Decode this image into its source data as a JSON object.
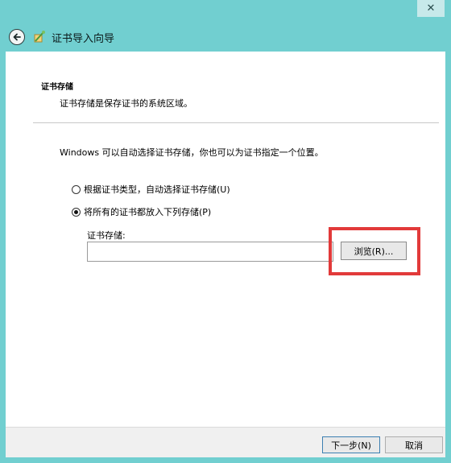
{
  "window": {
    "title": "证书导入向导",
    "close_label": "✕"
  },
  "section": {
    "title": "证书存储",
    "description": "证书存储是保存证书的系统区域。"
  },
  "content": {
    "intro": "Windows 可以自动选择证书存储，你也可以为证书指定一个位置。",
    "options": [
      {
        "label": "根据证书类型，自动选择证书存储(U)",
        "checked": false
      },
      {
        "label": "将所有的证书都放入下列存储(P)",
        "checked": true
      }
    ],
    "store_label": "证书存储:",
    "store_value": "",
    "browse_label": "浏览(R)..."
  },
  "footer": {
    "next_label": "下一步(N)",
    "cancel_label": "取消"
  },
  "colors": {
    "frame": "#71cfd0",
    "highlight": "#e23a3a"
  },
  "icons": {
    "back": "back-arrow-icon",
    "wizard": "certificate-wizard-icon",
    "close": "close-icon"
  }
}
